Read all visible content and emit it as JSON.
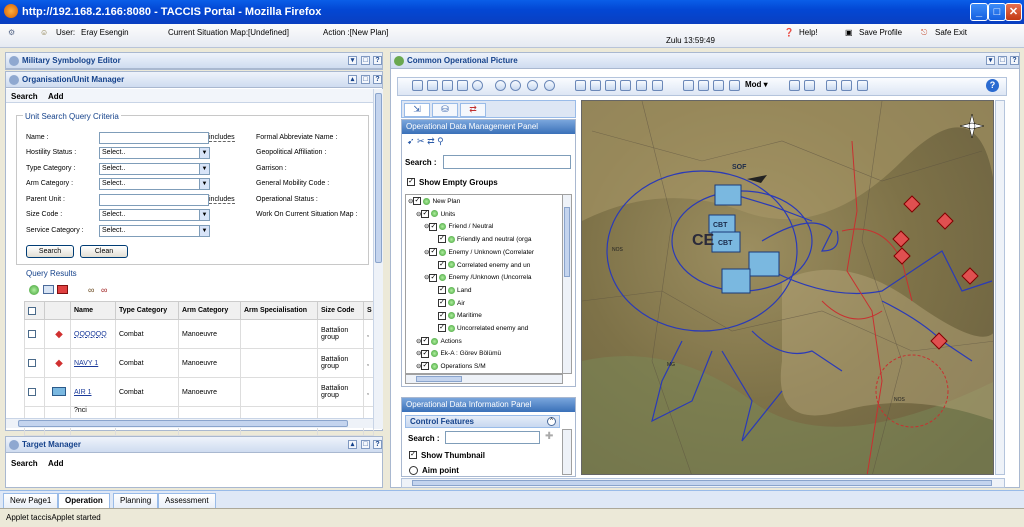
{
  "window": {
    "title": "http://192.168.2.166:8080 - TACCIS Portal - Mozilla Firefox"
  },
  "topbar": {
    "user_label": "User:",
    "user_name": "Eray Esengin",
    "situation_map": "Current Situation Map:[Undefined]",
    "action": "Action :[New Plan]",
    "clock": "Zulu 13:59:49",
    "help": "Help!",
    "save_profile": "Save Profile",
    "safe_exit": "Safe Exit"
  },
  "left": {
    "mse_title": "Military Symbology Editor",
    "org_title": "Organisation/Unit Manager",
    "menu_search": "Search",
    "menu_add": "Add",
    "criteria_title": "Unit Search Query Criteria",
    "fields": {
      "name": "Name :",
      "hostility": "Hostility Status :",
      "type_category": "Type Category :",
      "arm_category": "Arm Category :",
      "parent_unit": "Parent Unit :",
      "size_code": "Size Code :",
      "service_category": "Service Category :",
      "includes": "includes",
      "select": "Select..",
      "formal_abbr": "Formal Abbreviate Name :",
      "geopolitical": "Geopolitical Affiliation :",
      "garrison": "Garrison :",
      "mobility": "General Mobility Code :",
      "operational_status": "Operational Status :",
      "work_on_map": "Work On Current Situation Map :"
    },
    "search_btn": "Search",
    "clean_btn": "Clean",
    "results_title": "Query Results",
    "columns": [
      "Name",
      "Type Category",
      "Arm Category",
      "Arm Specialisation",
      "Size Code",
      "S"
    ],
    "rows": [
      {
        "name": "QQQQQQ",
        "type": "Combat",
        "arm": "Manoeuvre",
        "spec": "",
        "size": "Battalion group",
        "s": ","
      },
      {
        "name": "NAVY 1",
        "type": "Combat",
        "arm": "Manoeuvre",
        "spec": "",
        "size": "Battalion group",
        "s": ","
      },
      {
        "name": "AIR 1",
        "type": "Combat",
        "arm": "Manoeuvre",
        "spec": "",
        "size": "Battalion group",
        "s": ","
      },
      {
        "name": "?nci",
        "type": "",
        "arm": "",
        "spec": "",
        "size": "",
        "s": ""
      }
    ],
    "target_title": "Target Manager",
    "target_search": "Search",
    "target_add": "Add"
  },
  "cop": {
    "title": "Common Operational Picture",
    "mod_label": "Mod"
  },
  "odm": {
    "title": "Operational Data Management Panel",
    "search_label": "Search :",
    "show_empty": "Show Empty Groups",
    "tree": [
      "New Plan",
      "Units",
      "Friend / Neutral",
      "Friendly and neutral (orga",
      "Enemy / Unknown (Correlater",
      "Correlated enemy and un",
      "Enemy /Unknown (Uncorrela",
      "Land",
      "Air",
      "Maritime",
      "Uncorrelated enemy and",
      "Actions",
      "Ek-A : Görev Bölümü",
      "Operations S/M"
    ]
  },
  "odi": {
    "title": "Operational Data Information Panel",
    "control_features": "Control Features",
    "search_label": "Search :",
    "show_thumbnail": "Show Thumbnail",
    "aim_point": "Aim point"
  },
  "map": {
    "labels": [
      "SOF",
      "CBT",
      "CBT",
      "CE",
      "NOS",
      "NOS",
      "MG"
    ]
  },
  "tabs": [
    "New Page1",
    "Operation",
    "Planning",
    "Assessment"
  ],
  "status": "Applet taccisApplet started"
}
